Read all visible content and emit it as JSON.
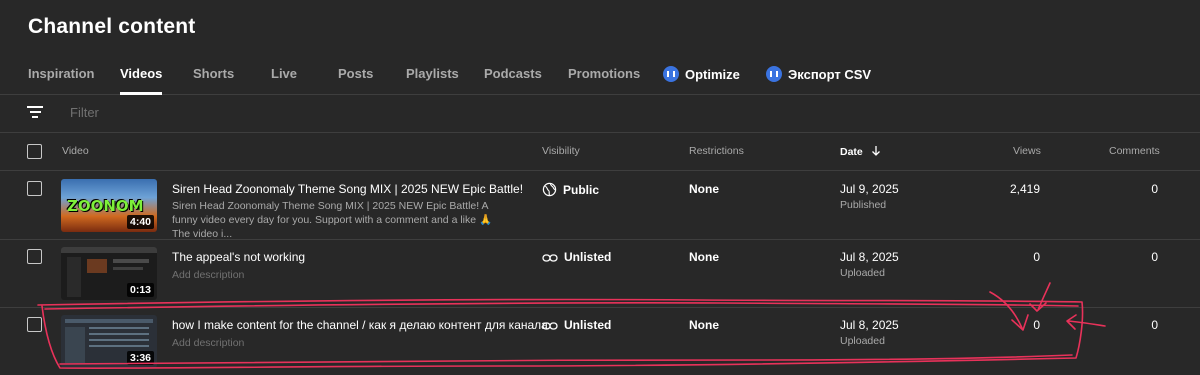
{
  "page_title": "Channel content",
  "tabs": [
    {
      "label": "Inspiration",
      "active": false
    },
    {
      "label": "Videos",
      "active": true
    },
    {
      "label": "Shorts",
      "active": false
    },
    {
      "label": "Live",
      "active": false
    },
    {
      "label": "Posts",
      "active": false
    },
    {
      "label": "Playlists",
      "active": false
    },
    {
      "label": "Podcasts",
      "active": false
    },
    {
      "label": "Promotions",
      "active": false
    },
    {
      "label": "Optimize",
      "active": false,
      "icon": "extension-icon"
    },
    {
      "label": "Экспорт CSV",
      "active": false,
      "icon": "extension-icon"
    }
  ],
  "filter": {
    "placeholder": "Filter",
    "icon": "filter-icon"
  },
  "columns": {
    "video": "Video",
    "visibility": "Visibility",
    "restrictions": "Restrictions",
    "date": "Date",
    "date_sort_icon": "arrow-down-icon",
    "views": "Views",
    "comments": "Comments"
  },
  "videos": [
    {
      "title": "Siren Head Zoonomaly Theme Song MIX | 2025 NEW Epic Battle!",
      "description": "Siren Head Zoonomaly Theme Song MIX | 2025 NEW Epic Battle! A funny video every day for you. Support with a comment and a like 🙏 The video i...",
      "duration": "4:40",
      "thumb_text": "ZOONOM",
      "visibility": "Public",
      "visibility_icon": "globe-icon",
      "restrictions": "None",
      "date": "Jul 9, 2025",
      "date_status": "Published",
      "views": "2,419",
      "comments": "0"
    },
    {
      "title": "The appeal's not working",
      "description": "Add description",
      "duration": "0:13",
      "visibility": "Unlisted",
      "visibility_icon": "link-icon",
      "restrictions": "None",
      "date": "Jul 8, 2025",
      "date_status": "Uploaded",
      "views": "0",
      "comments": "0"
    },
    {
      "title": "how I make content for the channel / как я делаю контент для канала",
      "description": "Add description",
      "duration": "3:36",
      "visibility": "Unlisted",
      "visibility_icon": "link-icon",
      "restrictions": "None",
      "date": "Jul 8, 2025",
      "date_status": "Uploaded",
      "views": "0",
      "comments": "0"
    }
  ],
  "colors": {
    "background": "#282828",
    "annotation": "#e8325a",
    "ext_icon": "#3a73e0"
  }
}
